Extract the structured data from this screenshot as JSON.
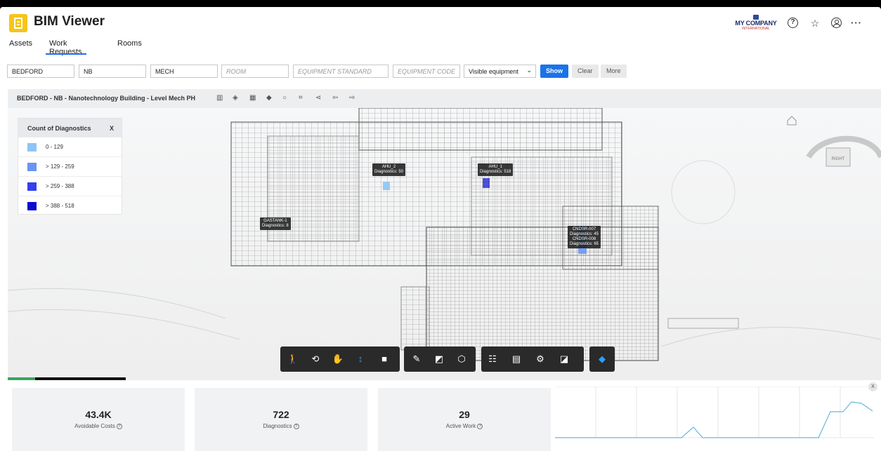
{
  "app": {
    "title": "BIM Viewer"
  },
  "company": {
    "name": "MY COMPANY",
    "sub": "INTERNATIONAL"
  },
  "header_icons": [
    "help-icon",
    "favorites-star-icon",
    "user-account-icon",
    "more-icon"
  ],
  "tabs": [
    {
      "label": "Assets",
      "active": false
    },
    {
      "label": "Work Requests",
      "active": true
    },
    {
      "label": "Rooms",
      "active": false
    }
  ],
  "filters": {
    "site": "BEDFORD",
    "building": "NB",
    "level": "MECH",
    "room_placeholder": "ROOM",
    "equipment_standard_placeholder": "EQUIPMENT STANDARD",
    "equipment_code_placeholder": "EQUIPMENT CODE",
    "visibility": "Visible equipment",
    "show_label": "Show",
    "clear_label": "Clear",
    "more_label": "More"
  },
  "viewer": {
    "title": "BEDFORD - NB - Nanotechnology Building - Level Mech PH",
    "legend": {
      "title": "Count of Diagnostics",
      "close": "X",
      "rows": [
        {
          "label": "0 - 129",
          "color": "#8ec5f5"
        },
        {
          "label": "> 129 - 259",
          "color": "#6a94f2"
        },
        {
          "label": "> 259 - 388",
          "color": "#3340ee"
        },
        {
          "label": "> 388 - 518",
          "color": "#0a0ad2"
        }
      ]
    },
    "labels": [
      {
        "name": "AHU_2",
        "diag": "Diagnostics: 50"
      },
      {
        "name": "AHU_1",
        "diag": "Diagnostics: 518"
      },
      {
        "name": "GASTANK-1",
        "diag": "Diagnostics: 8"
      },
      {
        "name": "CNDSR-007",
        "diag": "Diagnostics: 45"
      },
      {
        "name": "CNDSR-008",
        "diag": "Diagnostics: 65"
      }
    ],
    "viewcube_label": "RIGHT",
    "progress": 0.23
  },
  "stats": [
    {
      "value": "43.4K",
      "label": "Avoidable Costs"
    },
    {
      "value": "722",
      "label": "Diagnostics"
    },
    {
      "value": "29",
      "label": "Active Work"
    }
  ],
  "trend_close": "X"
}
